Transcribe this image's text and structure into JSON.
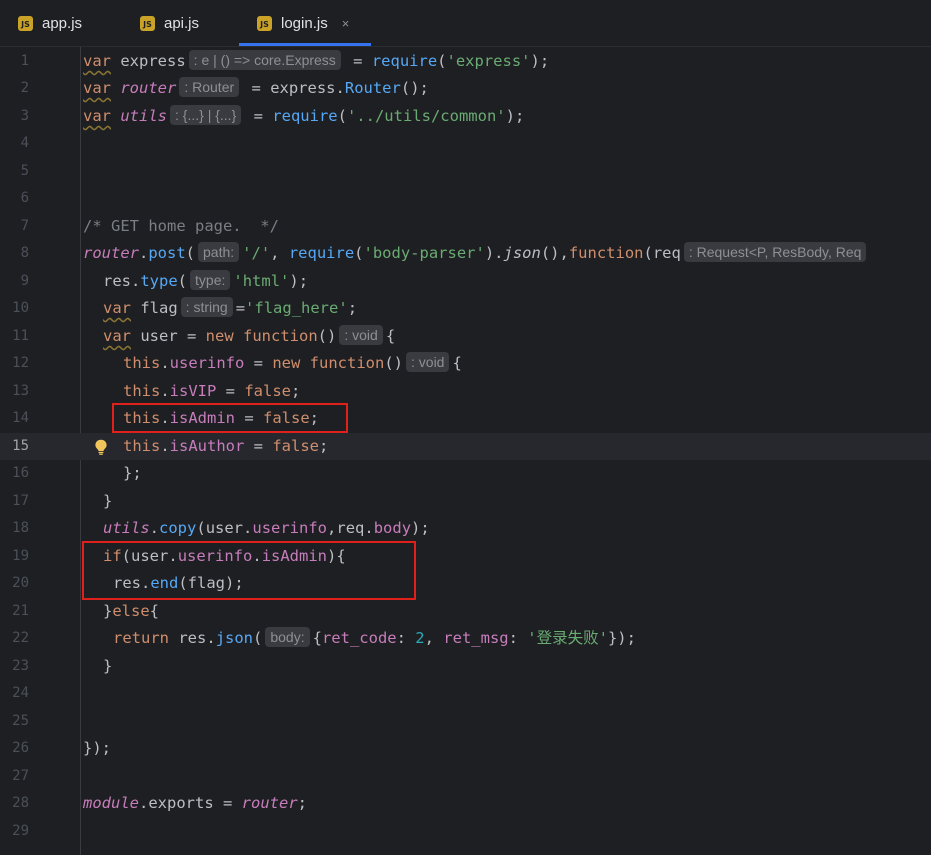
{
  "tabs": [
    {
      "icon": "JS",
      "label": "app.js",
      "active": false
    },
    {
      "icon": "JS",
      "label": "api.js",
      "active": false
    },
    {
      "icon": "JS",
      "label": "login.js",
      "active": true,
      "close": "×"
    }
  ],
  "colors": {
    "accent": "#3574f0",
    "highlight_box": "#e0201a",
    "js_icon": "#c9a227"
  },
  "lines": [
    {
      "n": "1",
      "t": [
        "var",
        "express",
        ": e | () => core.Express",
        "=",
        "require",
        "(",
        "'express'",
        ");"
      ]
    },
    {
      "n": "2",
      "t": [
        "var",
        "router",
        ": Router",
        "=",
        "express",
        ".",
        "Router",
        "();"
      ]
    },
    {
      "n": "3",
      "t": [
        "var",
        "utils",
        ": {...} | {...}",
        "=",
        "require",
        "(",
        "'../utils/common'",
        ");"
      ]
    },
    {
      "n": "4",
      "t": []
    },
    {
      "n": "5",
      "t": []
    },
    {
      "n": "6",
      "t": []
    },
    {
      "n": "7",
      "t": [
        "/* GET home page.  */"
      ]
    },
    {
      "n": "8",
      "t": [
        "router",
        ".",
        "post",
        "(",
        "path:",
        "'/'",
        ", ",
        "require",
        "(",
        "'body-parser'",
        ").",
        "json",
        "(),",
        "function",
        "(",
        "req",
        ": Request<P, ResBody, Req"
      ]
    },
    {
      "n": "9",
      "t": [
        "res",
        ".",
        "type",
        "(",
        "type:",
        "'html'",
        ");"
      ]
    },
    {
      "n": "10",
      "t": [
        "var",
        "flag",
        ": string",
        "=",
        "'flag_here'",
        ";"
      ]
    },
    {
      "n": "11",
      "t": [
        "var",
        "user",
        " = ",
        "new",
        "function",
        "()",
        ": void",
        "{"
      ]
    },
    {
      "n": "12",
      "t": [
        "this",
        ".",
        "userinfo",
        " = ",
        "new",
        "function",
        "()",
        ": void",
        "{"
      ]
    },
    {
      "n": "13",
      "t": [
        "this",
        ".",
        "isVIP",
        " = ",
        "false",
        ";"
      ]
    },
    {
      "n": "14",
      "t": [
        "this",
        ".",
        "isAdmin",
        " = ",
        "false",
        ";"
      ]
    },
    {
      "n": "15",
      "t": [
        "this",
        ".",
        "isAuthor",
        " = ",
        "false",
        ";"
      ]
    },
    {
      "n": "16",
      "t": [
        "};"
      ]
    },
    {
      "n": "17",
      "t": [
        "}"
      ]
    },
    {
      "n": "18",
      "t": [
        "utils",
        ".",
        "copy",
        "(",
        "user",
        ".",
        "userinfo",
        ",",
        "req",
        ".",
        "body",
        ");"
      ]
    },
    {
      "n": "19",
      "t": [
        "if",
        "(",
        "user",
        ".",
        "userinfo",
        ".",
        "isAdmin",
        "){"
      ]
    },
    {
      "n": "20",
      "t": [
        "res",
        ".",
        "end",
        "(flag);"
      ]
    },
    {
      "n": "21",
      "t": [
        "}",
        "else",
        "{"
      ]
    },
    {
      "n": "22",
      "t": [
        "return",
        "res",
        ".",
        "json",
        "(",
        "body:",
        "{",
        "ret_code",
        ": ",
        "2",
        ", ",
        "ret_msg",
        ": ",
        "'登录失败'",
        "});"
      ]
    },
    {
      "n": "23",
      "t": [
        "}"
      ]
    },
    {
      "n": "24",
      "t": []
    },
    {
      "n": "25",
      "t": []
    },
    {
      "n": "26",
      "t": [
        "});"
      ]
    },
    {
      "n": "27",
      "t": []
    },
    {
      "n": "28",
      "t": [
        "module",
        ".",
        "exports",
        " = ",
        "router",
        ";"
      ]
    },
    {
      "n": "29",
      "t": []
    }
  ]
}
